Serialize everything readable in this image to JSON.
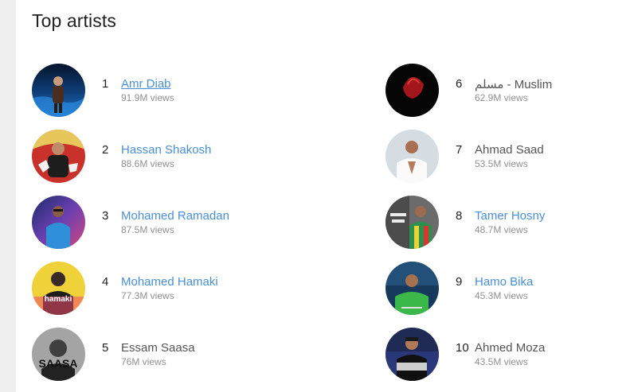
{
  "heading": "Top artists",
  "artists": [
    {
      "rank": "1",
      "name": "Amr Diab",
      "views": "91.9M views"
    },
    {
      "rank": "2",
      "name": "Hassan Shakosh",
      "views": "88.6M views"
    },
    {
      "rank": "3",
      "name": "Mohamed Ramadan",
      "views": "87.5M views"
    },
    {
      "rank": "4",
      "name": "Mohamed Hamaki",
      "views": "77.3M views"
    },
    {
      "rank": "5",
      "name": "Essam Saasa",
      "views": "76M views"
    },
    {
      "rank": "6",
      "name": "مسلم - Muslim",
      "views": "62.9M views"
    },
    {
      "rank": "7",
      "name": "Ahmad Saad",
      "views": "53.5M views"
    },
    {
      "rank": "8",
      "name": "Tamer Hosny",
      "views": "48.7M views"
    },
    {
      "rank": "9",
      "name": "Hamo Bika",
      "views": "45.3M views"
    },
    {
      "rank": "10",
      "name": "Ahmed Moza",
      "views": "43.5M views"
    }
  ],
  "avatar_labels": {
    "hamaki": "hamaki",
    "saasa": "SAASA"
  },
  "colors": {
    "link": "#4a8fd6",
    "plain_name": "#555555",
    "views": "#909090"
  }
}
